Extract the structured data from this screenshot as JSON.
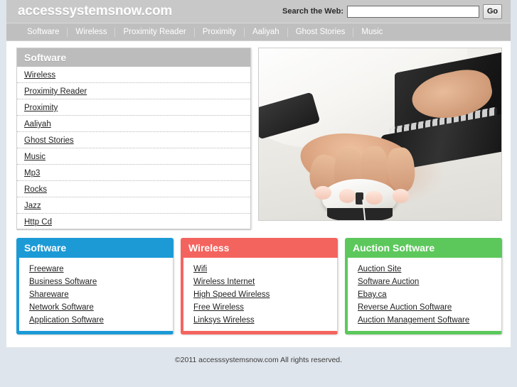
{
  "header": {
    "site_title": "accesssystemsnow.com",
    "search_label": "Search the Web:",
    "search_value": "",
    "search_placeholder": "",
    "go_label": "Go"
  },
  "nav": {
    "items": [
      {
        "label": "Software"
      },
      {
        "label": "Wireless"
      },
      {
        "label": "Proximity Reader"
      },
      {
        "label": "Proximity"
      },
      {
        "label": "Aaliyah"
      },
      {
        "label": "Ghost Stories"
      },
      {
        "label": "Music"
      }
    ]
  },
  "sidebar": {
    "title": "Software",
    "items": [
      {
        "label": "Wireless"
      },
      {
        "label": "Proximity Reader"
      },
      {
        "label": "Proximity"
      },
      {
        "label": "Aaliyah"
      },
      {
        "label": "Ghost Stories"
      },
      {
        "label": "Music"
      },
      {
        "label": "Mp3"
      },
      {
        "label": "Rocks"
      },
      {
        "label": "Jazz"
      },
      {
        "label": "Http Cd"
      }
    ]
  },
  "hero": {
    "alt": "hands-on-mouse-and-laptop-photo"
  },
  "panels": [
    {
      "title": "Software",
      "color": "#1c9ad6",
      "items": [
        {
          "label": "Freeware"
        },
        {
          "label": "Business Software"
        },
        {
          "label": "Shareware"
        },
        {
          "label": "Network Software"
        },
        {
          "label": "Application Software"
        }
      ]
    },
    {
      "title": "Wireless",
      "color": "#f4645f",
      "items": [
        {
          "label": "Wifi"
        },
        {
          "label": "Wireless Internet"
        },
        {
          "label": "High Speed Wireless"
        },
        {
          "label": "Free Wireless"
        },
        {
          "label": "Linksys Wireless"
        }
      ]
    },
    {
      "title": "Auction Software",
      "color": "#5cc85c",
      "items": [
        {
          "label": "Auction Site"
        },
        {
          "label": "Software Auction"
        },
        {
          "label": "Ebay.ca"
        },
        {
          "label": "Reverse Auction Software"
        },
        {
          "label": "Auction Management Software"
        }
      ]
    }
  ],
  "footer": {
    "copyright": "©2011 accesssystemsnow.com All rights reserved."
  }
}
